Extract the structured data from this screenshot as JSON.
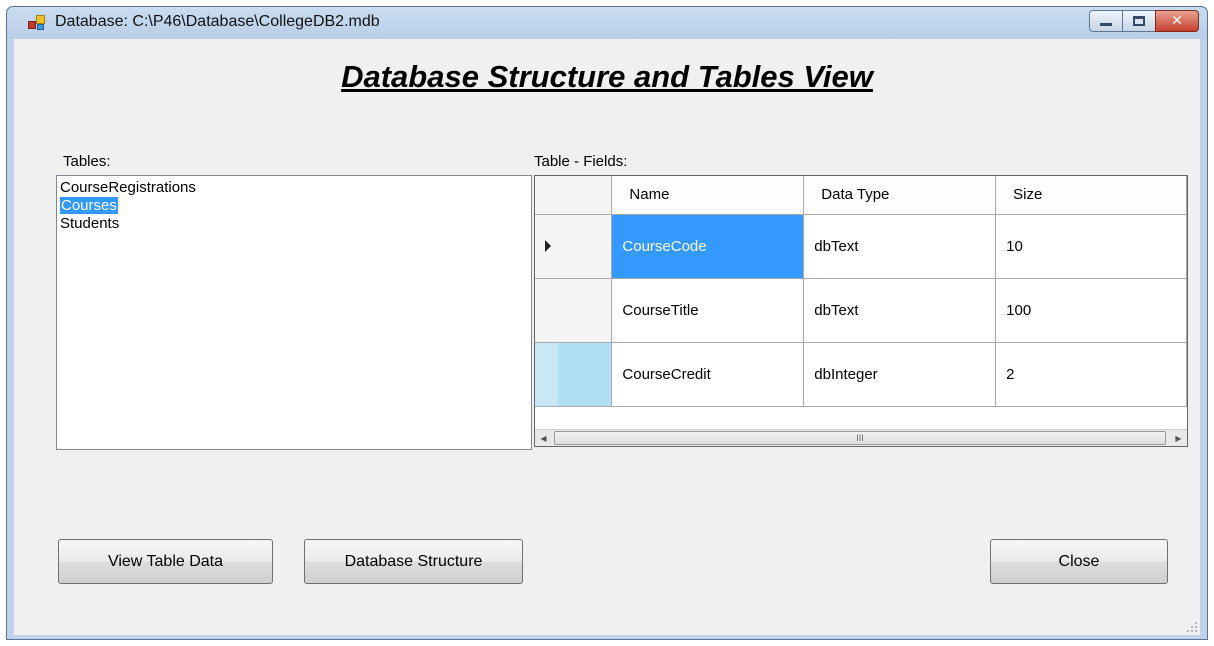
{
  "window": {
    "title": "Database: C:\\P46\\Database\\CollegeDB2.mdb",
    "icon": "database-app-icon",
    "minimize_label": "",
    "maximize_label": "",
    "close_label": "✕"
  },
  "heading": "Database Structure and Tables View",
  "tables_panel": {
    "label": "Tables:",
    "items": [
      {
        "label": "CourseRegistrations",
        "selected": false
      },
      {
        "label": "Courses",
        "selected": true
      },
      {
        "label": "Students",
        "selected": false
      }
    ]
  },
  "fields_panel": {
    "label": "Table - Fields:",
    "columns": [
      "Name",
      "Data Type",
      "Size"
    ],
    "rows": [
      {
        "name": "CourseCode",
        "type": "dbText",
        "size": "10"
      },
      {
        "name": "CourseTitle",
        "type": "dbText",
        "size": "100"
      },
      {
        "name": "CourseCredit",
        "type": "dbInteger",
        "size": "2"
      }
    ],
    "scrollbar_thumb_glyph": "III"
  },
  "buttons": {
    "view_table_data": "View Table Data",
    "database_structure": "Database Structure",
    "close": "Close"
  },
  "colors": {
    "selection": "#3399ff",
    "frame": "#bcd3ea",
    "client": "#f0f0f0"
  }
}
